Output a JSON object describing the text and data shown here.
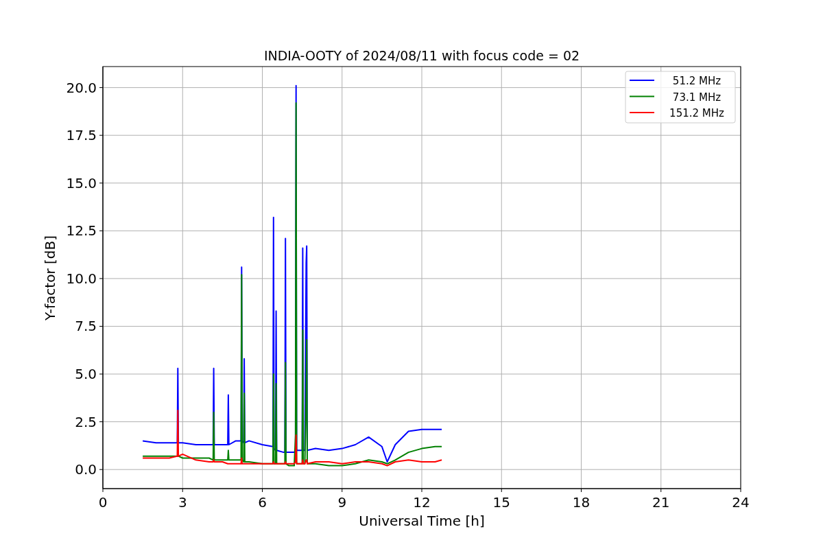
{
  "plot": {
    "chart_data": {
      "type": "line",
      "title": "INDIA-OOTY of 2024/08/11 with focus code = 02",
      "xlabel": "Universal Time [h]",
      "ylabel": "Y-factor [dB]",
      "x": [
        1.5,
        2,
        2.5,
        2.8,
        2.82,
        2.84,
        3,
        3.5,
        4,
        4.15,
        4.17,
        4.19,
        4.5,
        4.7,
        4.72,
        4.74,
        5,
        5.2,
        5.22,
        5.24,
        5.3,
        5.32,
        5.34,
        5.5,
        6,
        6.4,
        6.42,
        6.44,
        6.5,
        6.52,
        6.54,
        6.8,
        6.85,
        6.87,
        6.89,
        7,
        7.2,
        7.25,
        7.27,
        7.29,
        7.5,
        7.52,
        7.54,
        7.6,
        7.65,
        7.67,
        7.69,
        8,
        8.5,
        9,
        9.5,
        10,
        10.5,
        10.7,
        11,
        11.5,
        12,
        12.5,
        12.75
      ],
      "series": [
        {
          "name": "51.2 MHz",
          "color": "#0000ff",
          "values": [
            1.5,
            1.4,
            1.4,
            1.4,
            5.3,
            1.4,
            1.4,
            1.3,
            1.3,
            1.3,
            5.3,
            1.3,
            1.3,
            1.3,
            3.9,
            1.3,
            1.5,
            1.5,
            10.6,
            1.5,
            1.4,
            5.8,
            1.4,
            1.5,
            1.3,
            1.2,
            13.2,
            1.1,
            1.0,
            8.3,
            1.0,
            0.9,
            0.9,
            12.1,
            0.9,
            0.9,
            0.9,
            1.0,
            20.1,
            1.0,
            1.0,
            11.6,
            1.0,
            1.0,
            10.8,
            11.7,
            1.0,
            1.1,
            1.0,
            1.1,
            1.3,
            1.7,
            1.2,
            0.4,
            1.3,
            2.0,
            2.1,
            2.1,
            2.1
          ]
        },
        {
          "name": "73.1 MHz",
          "color": "#008000",
          "values": [
            0.7,
            0.7,
            0.7,
            0.7,
            0.7,
            0.7,
            0.6,
            0.6,
            0.6,
            0.5,
            3.0,
            0.5,
            0.5,
            0.5,
            1.0,
            0.5,
            0.5,
            0.5,
            10.2,
            0.5,
            0.4,
            4.0,
            0.4,
            0.4,
            0.3,
            0.3,
            5.0,
            0.3,
            0.3,
            4.5,
            0.3,
            0.3,
            0.3,
            5.6,
            0.3,
            0.2,
            0.2,
            1.8,
            19.2,
            0.3,
            0.3,
            7.3,
            0.3,
            0.3,
            4.0,
            6.8,
            0.3,
            0.3,
            0.2,
            0.2,
            0.3,
            0.5,
            0.4,
            0.3,
            0.5,
            0.9,
            1.1,
            1.2,
            1.2
          ]
        },
        {
          "name": "151.2 MHz",
          "color": "#ff0000",
          "values": [
            0.6,
            0.6,
            0.6,
            0.7,
            3.1,
            0.7,
            0.8,
            0.5,
            0.4,
            0.4,
            0.5,
            0.4,
            0.4,
            0.3,
            0.3,
            0.3,
            0.3,
            0.3,
            0.6,
            0.3,
            0.3,
            0.3,
            0.3,
            0.3,
            0.3,
            0.3,
            0.4,
            0.3,
            0.3,
            0.3,
            0.3,
            0.3,
            0.3,
            0.4,
            0.3,
            0.3,
            0.3,
            0.4,
            1.8,
            0.3,
            0.3,
            0.5,
            0.3,
            0.3,
            0.5,
            0.5,
            0.3,
            0.4,
            0.4,
            0.3,
            0.4,
            0.4,
            0.3,
            0.2,
            0.4,
            0.5,
            0.4,
            0.4,
            0.5
          ]
        }
      ],
      "grid": true,
      "legend": true,
      "xlim": [
        0,
        24
      ],
      "ylim": [
        -1,
        21.1
      ],
      "xticks": [
        0,
        3,
        6,
        9,
        12,
        15,
        18,
        21,
        24
      ],
      "yticks": [
        {
          "value": 0,
          "label": "0.0"
        },
        {
          "value": 2.5,
          "label": "2.5"
        },
        {
          "value": 5,
          "label": "5.0"
        },
        {
          "value": 7.5,
          "label": "7.5"
        },
        {
          "value": 10,
          "label": "10.0"
        },
        {
          "value": 12.5,
          "label": "12.5"
        },
        {
          "value": 15,
          "label": "15.0"
        },
        {
          "value": 17.5,
          "label": "17.5"
        },
        {
          "value": 20,
          "label": "20.0"
        }
      ]
    }
  }
}
